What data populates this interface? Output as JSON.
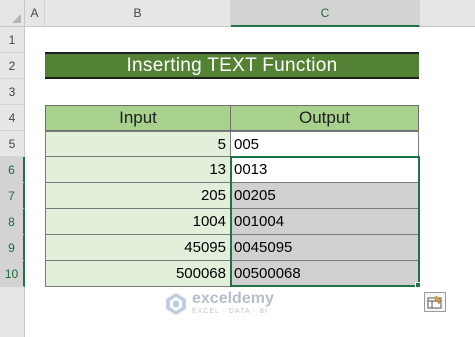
{
  "columns": [
    "A",
    "B",
    "C"
  ],
  "rows": [
    "1",
    "2",
    "3",
    "4",
    "5",
    "6",
    "7",
    "8",
    "9",
    "10"
  ],
  "title": "Inserting TEXT Function",
  "table": {
    "headers": [
      "Input",
      "Output"
    ],
    "inputs": [
      "5",
      "13",
      "205",
      "1004",
      "45095",
      "500068"
    ],
    "outputs": [
      "005",
      "0013",
      "00205",
      "001004",
      "0045095",
      "00500068"
    ]
  },
  "watermark": {
    "name": "exceldemy",
    "tagline": "EXCEL · DATA · BI"
  },
  "colors": {
    "title_bg": "#548235",
    "header_bg": "#a9d18e",
    "input_bg": "#e2efda",
    "selection": "#217346",
    "selected_fill": "#d0d0d0"
  },
  "icons": {
    "quick_analysis": "quick-analysis-icon",
    "watermark_logo": "exceldemy-logo-icon"
  }
}
